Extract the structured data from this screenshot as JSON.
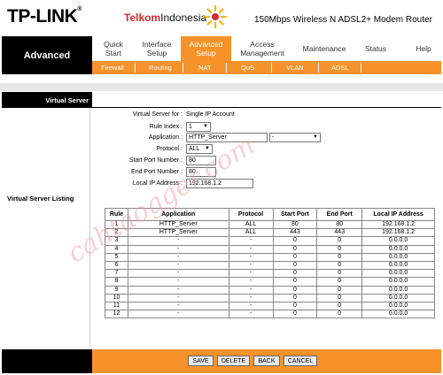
{
  "header": {
    "brand": "TP-LINK",
    "brand_mark": "®",
    "partner_brand": "Telkom",
    "partner_brand_suffix": "Indonesia",
    "model": "150Mbps Wireless N ADSL2+ Modem Router"
  },
  "nav": {
    "section": "Advanced",
    "tabs": [
      {
        "label": "Quick Start"
      },
      {
        "label": "Interface Setup"
      },
      {
        "label": "Advanced Setup"
      },
      {
        "label": "Access Management"
      },
      {
        "label": "Maintenance"
      },
      {
        "label": "Status"
      },
      {
        "label": "Help"
      }
    ],
    "subtabs": [
      "Firewall",
      "Routing",
      "NAT",
      "QoS",
      "VLAN",
      "ADSL"
    ]
  },
  "sidebar": {
    "virtual_server": "Virtual Server",
    "virtual_server_listing": "Virtual Server Listing"
  },
  "form": {
    "vs_for_label": "Virtual Server for :",
    "vs_for_value": "Single IP Account",
    "rule_index_label": "Rule Index :",
    "rule_index_value": "1",
    "application_label": "Application :",
    "application_value": "HTTP_Server",
    "application_select": "-",
    "protocol_label": "Protocol :",
    "protocol_value": "ALL",
    "start_port_label": "Start Port Number :",
    "start_port_value": "80",
    "end_port_label": "End Port Number :",
    "end_port_value": "80",
    "local_ip_label": "Local IP Address :",
    "local_ip_value": "192.168.1.2"
  },
  "table": {
    "headers": [
      "Rule",
      "Application",
      "Protocol",
      "Start Port",
      "End Port",
      "Local IP Address"
    ],
    "rows": [
      [
        "1",
        "HTTP_Server",
        "ALL",
        "80",
        "80",
        "192.168.1.2"
      ],
      [
        "2",
        "HTTP_Server",
        "ALL",
        "443",
        "443",
        "192.168.1.2"
      ],
      [
        "3",
        "-",
        "-",
        "0",
        "0",
        "0.0.0.0"
      ],
      [
        "4",
        "-",
        "-",
        "0",
        "0",
        "0.0.0.0"
      ],
      [
        "5",
        "-",
        "-",
        "0",
        "0",
        "0.0.0.0"
      ],
      [
        "6",
        "-",
        "-",
        "0",
        "0",
        "0.0.0.0"
      ],
      [
        "7",
        "-",
        "-",
        "0",
        "0",
        "0.0.0.0"
      ],
      [
        "8",
        "-",
        "-",
        "0",
        "0",
        "0.0.0.0"
      ],
      [
        "9",
        "-",
        "-",
        "0",
        "0",
        "0.0.0.0"
      ],
      [
        "10",
        "-",
        "-",
        "0",
        "0",
        "0.0.0.0"
      ],
      [
        "11",
        "-",
        "-",
        "0",
        "0",
        "0.0.0.0"
      ],
      [
        "12",
        "-",
        "-",
        "0",
        "0",
        "0.0.0.0"
      ]
    ]
  },
  "buttons": {
    "save": "SAVE",
    "delete": "DELETE",
    "back": "BACK",
    "cancel": "CANCEL"
  },
  "watermark": "cahtaogger.com",
  "colors": {
    "accent": "#f5922a",
    "dark": "#000000",
    "telkom_red": "#d8282f"
  }
}
